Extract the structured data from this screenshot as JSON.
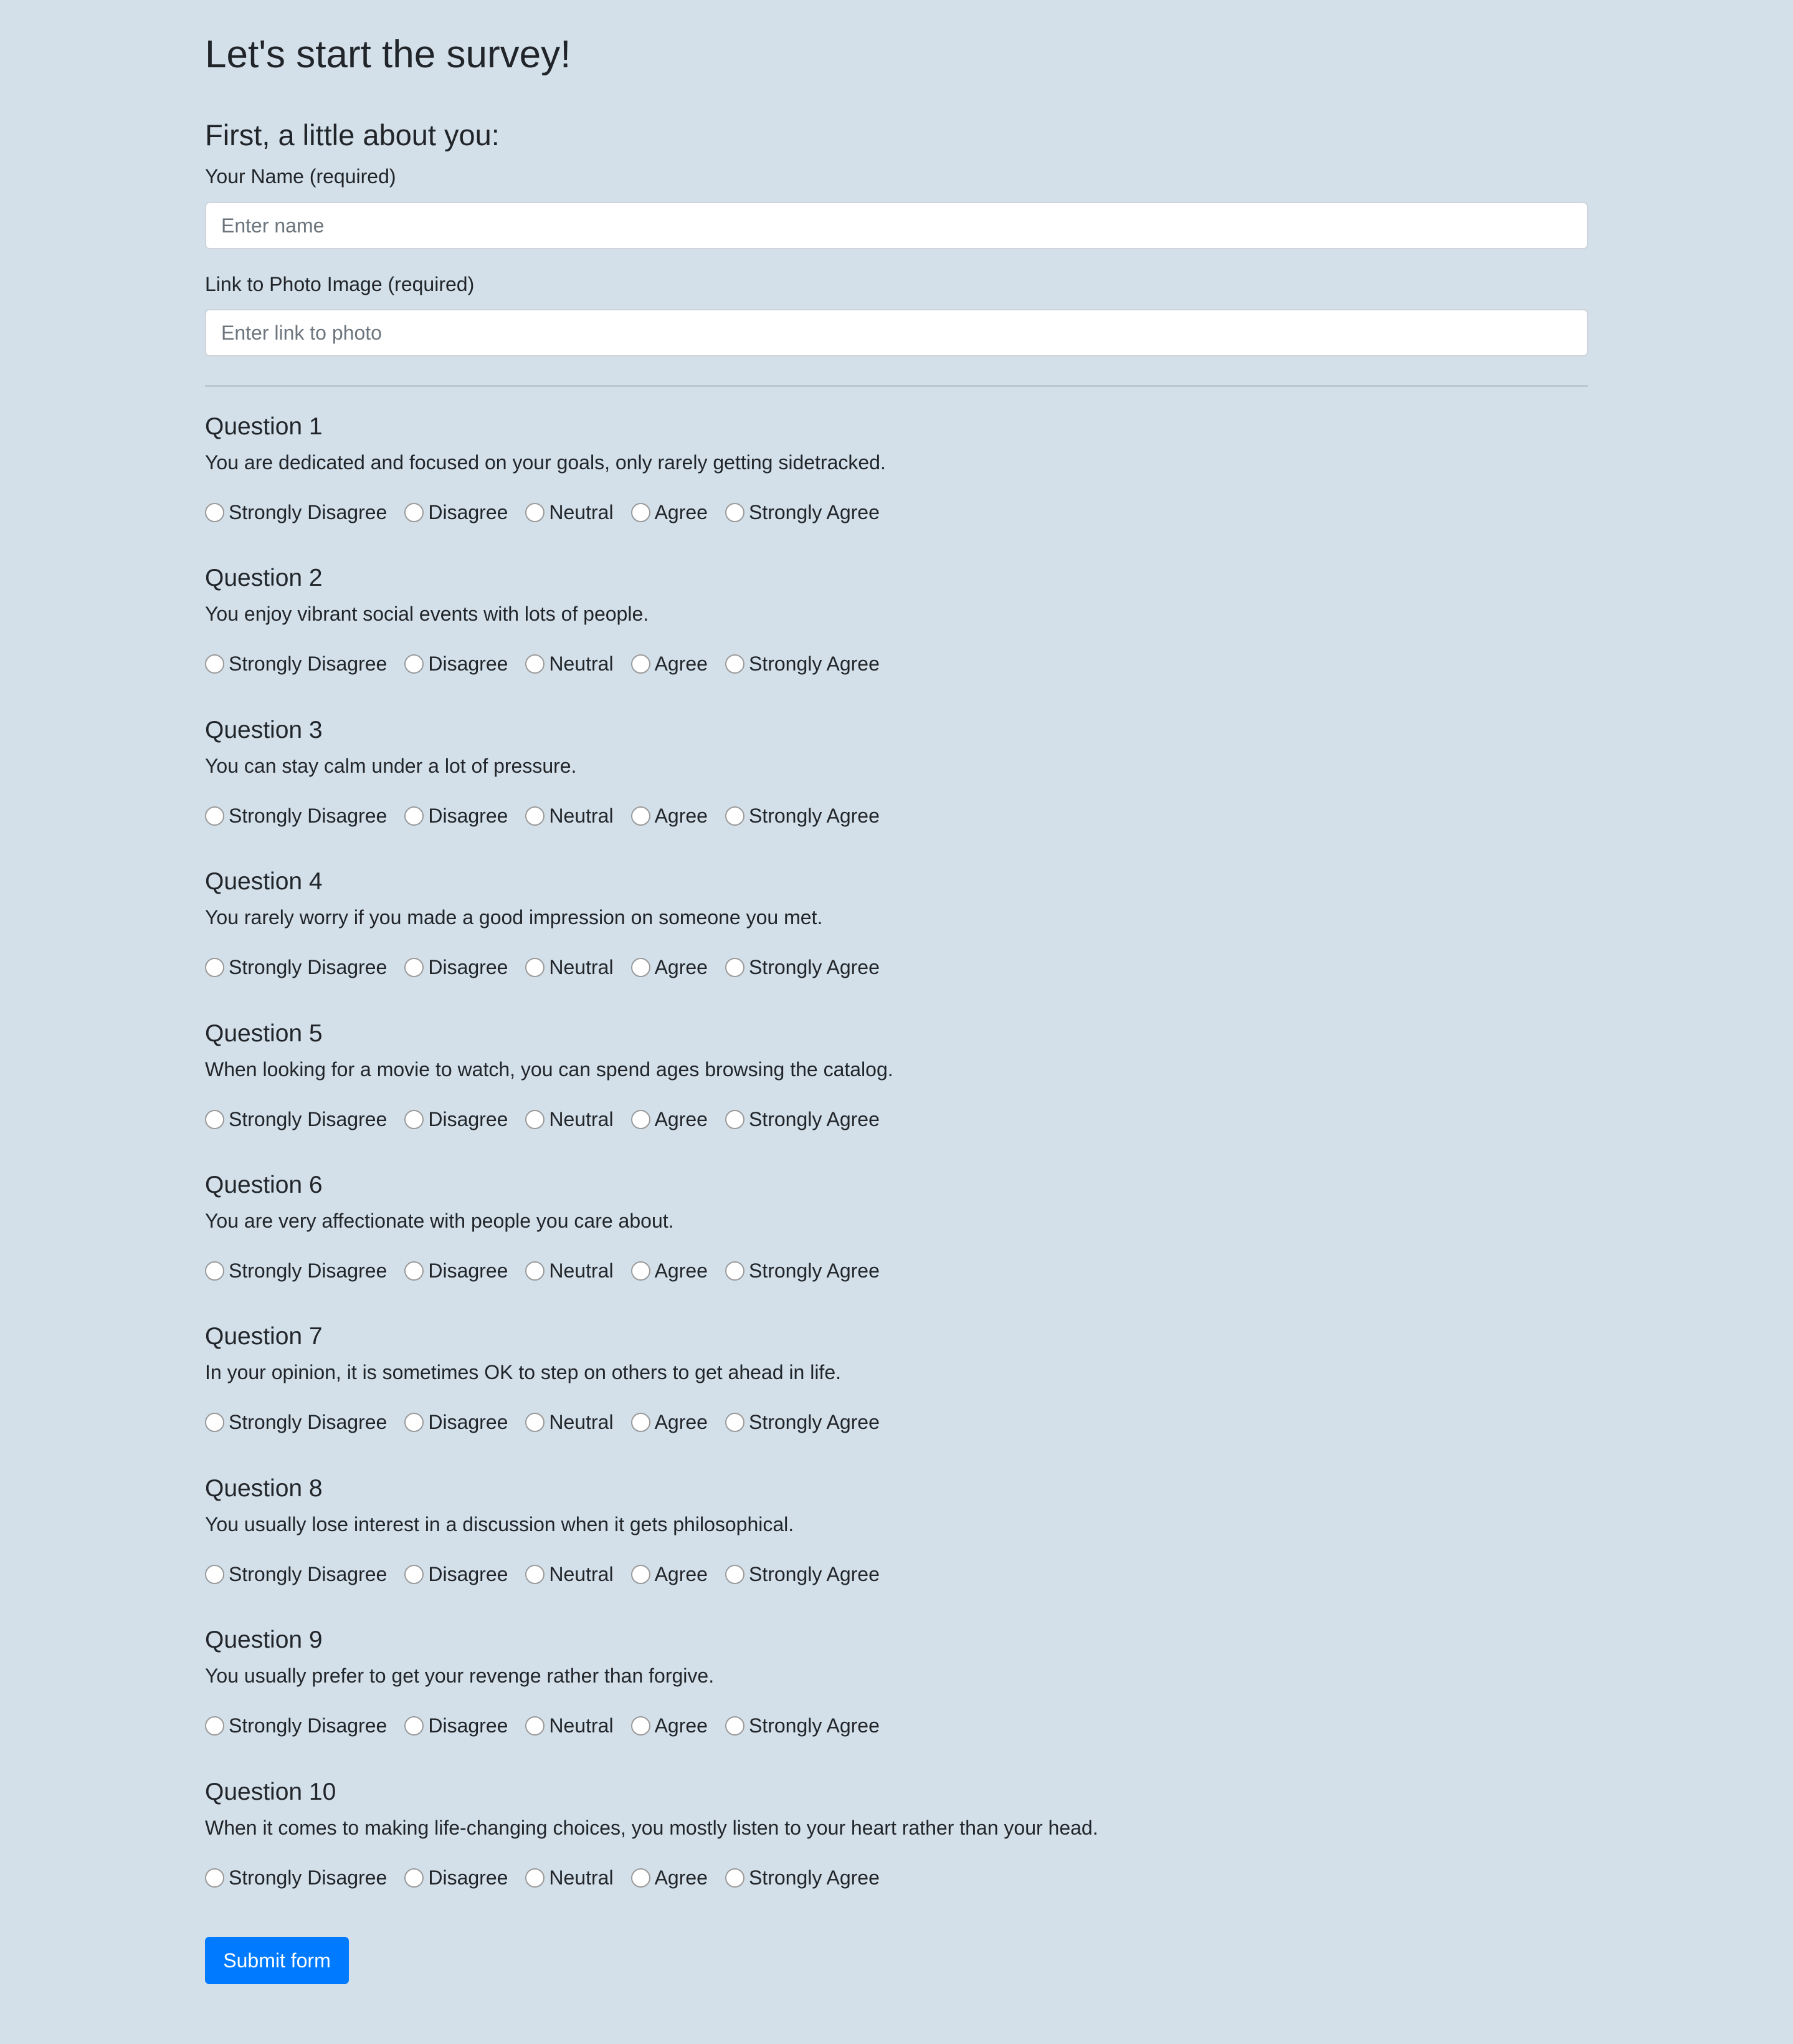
{
  "page": {
    "title": "Let's start the survey!",
    "section_title": "First, a little about you:"
  },
  "fields": {
    "name_label": "Your Name (required)",
    "name_placeholder": "Enter name",
    "name_value": "",
    "photo_label": "Link to Photo Image (required)",
    "photo_placeholder": "Enter link to photo",
    "photo_value": ""
  },
  "options": [
    "Strongly Disagree",
    "Disagree",
    "Neutral",
    "Agree",
    "Strongly Agree"
  ],
  "questions": [
    {
      "title": "Question 1",
      "text": "You are dedicated and focused on your goals, only rarely getting sidetracked."
    },
    {
      "title": "Question 2",
      "text": "You enjoy vibrant social events with lots of people."
    },
    {
      "title": "Question 3",
      "text": "You can stay calm under a lot of pressure."
    },
    {
      "title": "Question 4",
      "text": "You rarely worry if you made a good impression on someone you met."
    },
    {
      "title": "Question 5",
      "text": "When looking for a movie to watch, you can spend ages browsing the catalog."
    },
    {
      "title": "Question 6",
      "text": "You are very affectionate with people you care about."
    },
    {
      "title": "Question 7",
      "text": "In your opinion, it is sometimes OK to step on others to get ahead in life."
    },
    {
      "title": "Question 8",
      "text": "You usually lose interest in a discussion when it gets philosophical."
    },
    {
      "title": "Question 9",
      "text": "You usually prefer to get your revenge rather than forgive."
    },
    {
      "title": "Question 10",
      "text": "When it comes to making life-changing choices, you mostly listen to your heart rather than your head."
    }
  ],
  "submit_label": "Submit form",
  "colors": {
    "background": "#d3e0ea",
    "primary": "#007bff",
    "text": "#212529"
  }
}
